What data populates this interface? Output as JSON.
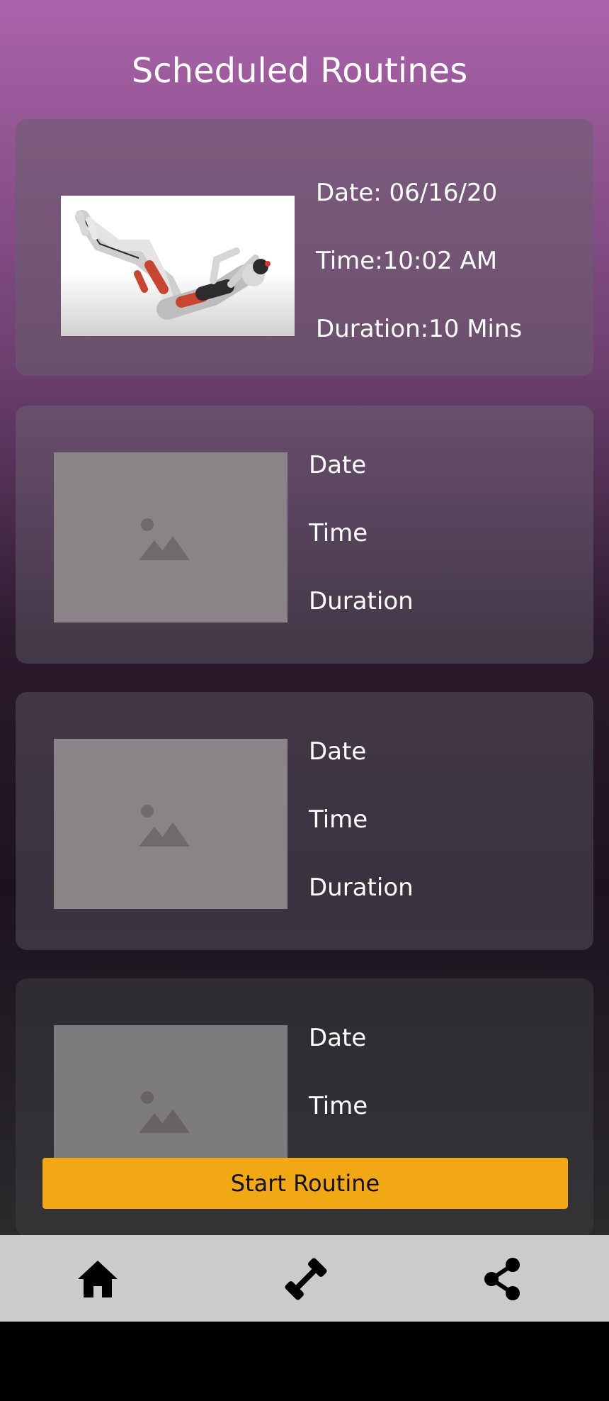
{
  "header": {
    "title": "Scheduled Routines"
  },
  "routines": [
    {
      "date": "Date: 06/16/20",
      "time": "Time:10:02 AM",
      "duration": "Duration:10 Mins",
      "image": "exercise-illustration"
    },
    {
      "date": "Date",
      "time": "Time",
      "duration": "Duration",
      "image": "image-placeholder-icon"
    },
    {
      "date": "Date",
      "time": "Time",
      "duration": "Duration",
      "image": "image-placeholder-icon"
    },
    {
      "date": "Date",
      "time": "Time",
      "image": "image-placeholder-icon"
    }
  ],
  "actions": {
    "start_label": "Start Routine"
  },
  "bottom_nav": [
    {
      "icon": "home-icon"
    },
    {
      "icon": "dumbbell-icon"
    },
    {
      "icon": "share-icon"
    }
  ],
  "colors": {
    "accent": "#f2a714",
    "nav_background": "#cbcbcb",
    "gradient_top": "#ab63ab"
  }
}
